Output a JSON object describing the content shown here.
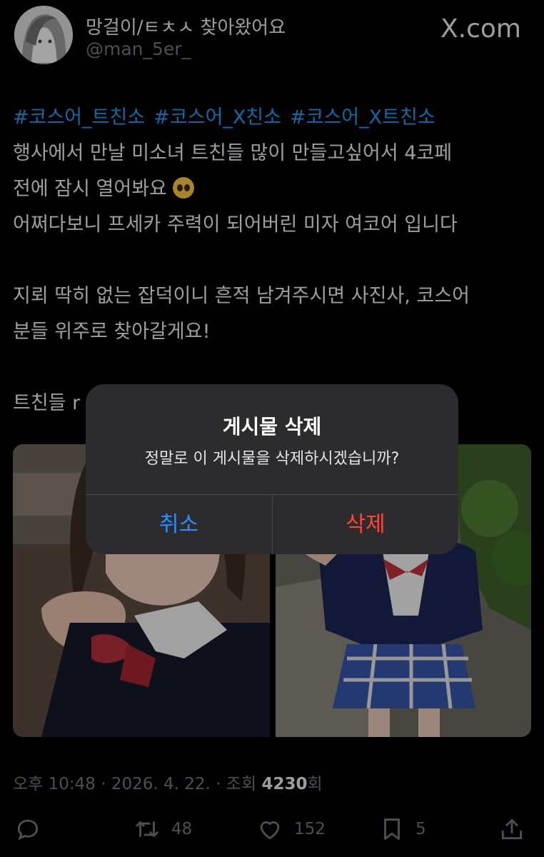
{
  "header": {
    "display_name": "망걸이/ㅌㅊㅅ 찾아왔어요",
    "handle": "@man_5er_",
    "brand": "X.com",
    "brand_icon": "x-logo"
  },
  "post": {
    "hashtags": [
      "#코스어_트친소",
      "#코스어_X친소",
      "#코스어_X트친소"
    ],
    "line1": "행사에서 만날 미소녀 트친들 많이 만들고싶어서 4코페",
    "line2": "전에 잠시 열어봐요",
    "line2_emoji": "pleading-face-emoji",
    "line3": "어쩌다보니 프세카 주력이 되어버린 미자 여코어 입니다",
    "line4": "지뢰 딱히 없는 잡덕이니 흔적 남겨주시면 사진사, 코스어",
    "line5": "분들 위주로 찾아갈게요!",
    "line6": "트친들 r"
  },
  "dialog": {
    "title": "게시물 삭제",
    "message": "정말로 이 게시물을 삭제하시겠습니까?",
    "cancel_label": "취소",
    "delete_label": "삭제",
    "cancel_color": "#2f8cff",
    "delete_color": "#ff453a"
  },
  "meta": {
    "time": "오후 10:48",
    "date": "2026. 4. 22.",
    "views_label": "조회",
    "views_count": "4230",
    "views_suffix": "회"
  },
  "actions": {
    "reply_icon": "comment-icon",
    "retweet_icon": "retweet-icon",
    "retweet_count": "48",
    "like_icon": "heart-icon",
    "like_count": "152",
    "bookmark_icon": "bookmark-icon",
    "bookmark_count": "5",
    "share_icon": "share-icon"
  },
  "colors": {
    "background": "#000000",
    "hashtag": "#1d9bf0",
    "secondary_text": "#71767b",
    "dialog_bg": "#2c2c2e"
  }
}
